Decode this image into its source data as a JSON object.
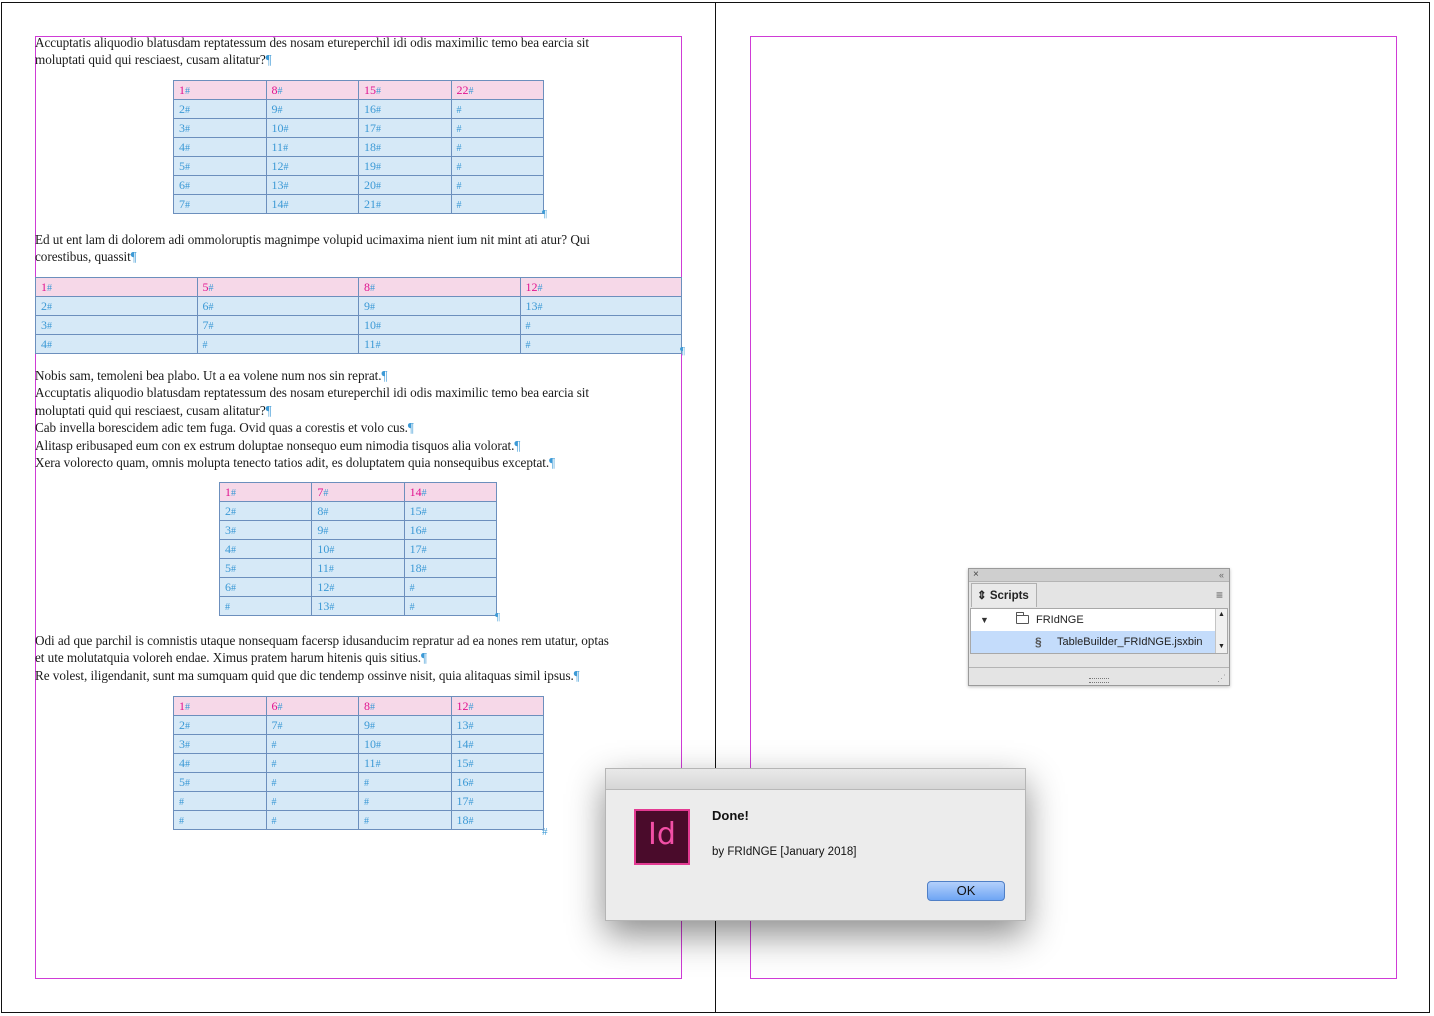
{
  "document": {
    "paragraph_mark": "¶",
    "cell_marker": "#",
    "left_page": {
      "para1": [
        "Accuptatis aliquodio blatusdam reptatessum des nosam etureperchil idi odis maximilic temo bea earcia sit",
        "moluptati quid qui resciaest, cusam alitatur?"
      ],
      "table1": [
        [
          "1",
          "8",
          "15",
          "22"
        ],
        [
          "2",
          "9",
          "16",
          ""
        ],
        [
          "3",
          "10",
          "17",
          ""
        ],
        [
          "4",
          "11",
          "18",
          ""
        ],
        [
          "5",
          "12",
          "19",
          ""
        ],
        [
          "6",
          "13",
          "20",
          ""
        ],
        [
          "7",
          "14",
          "21",
          ""
        ]
      ],
      "para2": [
        "Ed ut ent lam di dolorem adi ommoloruptis magnimpe volupid ucimaxima nient ium nit mint ati atur? Qui",
        "corestibus, quassit"
      ],
      "table2": [
        [
          "1",
          "5",
          "8",
          "12"
        ],
        [
          "2",
          "6",
          "9",
          "13"
        ],
        [
          "3",
          "7",
          "10",
          ""
        ],
        [
          "4",
          "",
          "11",
          ""
        ]
      ],
      "para3": [
        "Nobis sam, temoleni bea plabo. Ut a ea volene num nos sin reprat.",
        "Accuptatis aliquodio blatusdam reptatessum des nosam etureperchil idi odis maximilic temo bea earcia sit",
        "moluptati quid qui resciaest, cusam alitatur?",
        "Cab invella borescidem adic tem fuga. Ovid quas a corestis et volo cus.",
        "Alitasp eribusaped eum con ex estrum doluptae nonsequo eum nimodia tisquos alia volorat.",
        "Xera volorecto quam, omnis molupta tenecto tatios adit, es doluptatem quia nonsequibus exceptat."
      ],
      "table3": [
        [
          "1",
          "7",
          "14"
        ],
        [
          "2",
          "8",
          "15"
        ],
        [
          "3",
          "9",
          "16"
        ],
        [
          "4",
          "10",
          "17"
        ],
        [
          "5",
          "11",
          "18"
        ],
        [
          "6",
          "12",
          ""
        ],
        [
          "",
          "13",
          ""
        ]
      ],
      "para4": [
        "Odi ad que parchil is comnistis utaque nonsequam facersp idusanducim repratur ad ea nones rem utatur, optas",
        "et ute molutatquia voloreh endae. Ximus pratem harum hitenis quis sitius.",
        "Re volest, iligendanit, sunt ma sumquam quid que dic tendemp ossinve nisit, quia alitaquas simil ipsus."
      ],
      "table4": [
        [
          "1",
          "6",
          "8",
          "12"
        ],
        [
          "2",
          "7",
          "9",
          "13"
        ],
        [
          "3",
          "",
          "10",
          "14"
        ],
        [
          "4",
          "",
          "11",
          "15"
        ],
        [
          "5",
          "",
          "",
          "16"
        ],
        [
          "",
          "",
          "",
          "17"
        ],
        [
          "",
          "",
          "",
          "18"
        ]
      ]
    }
  },
  "scripts_panel": {
    "close_glyph": "×",
    "collapse_glyph": "«",
    "tab_label": "Scripts",
    "tab_icon": "sort-arrows-icon",
    "menu_icon": "panel-menu-icon",
    "folder_name": "FRIdNGE",
    "script_name": "TableBuilder_FRIdNGE.jsxbin"
  },
  "dialog": {
    "app_icon_text": "Id",
    "heading": "Done!",
    "message": "by FRIdNGE [January 2018]",
    "ok_label": "OK"
  },
  "colors": {
    "margin_guide": "#cf3bd6",
    "header_row_fill": "#f6d8e8",
    "body_row_fill": "#d6e9f7",
    "header_text": "#e0148f",
    "body_text": "#3d9ad6",
    "indesign_brand": "#e33a92"
  }
}
